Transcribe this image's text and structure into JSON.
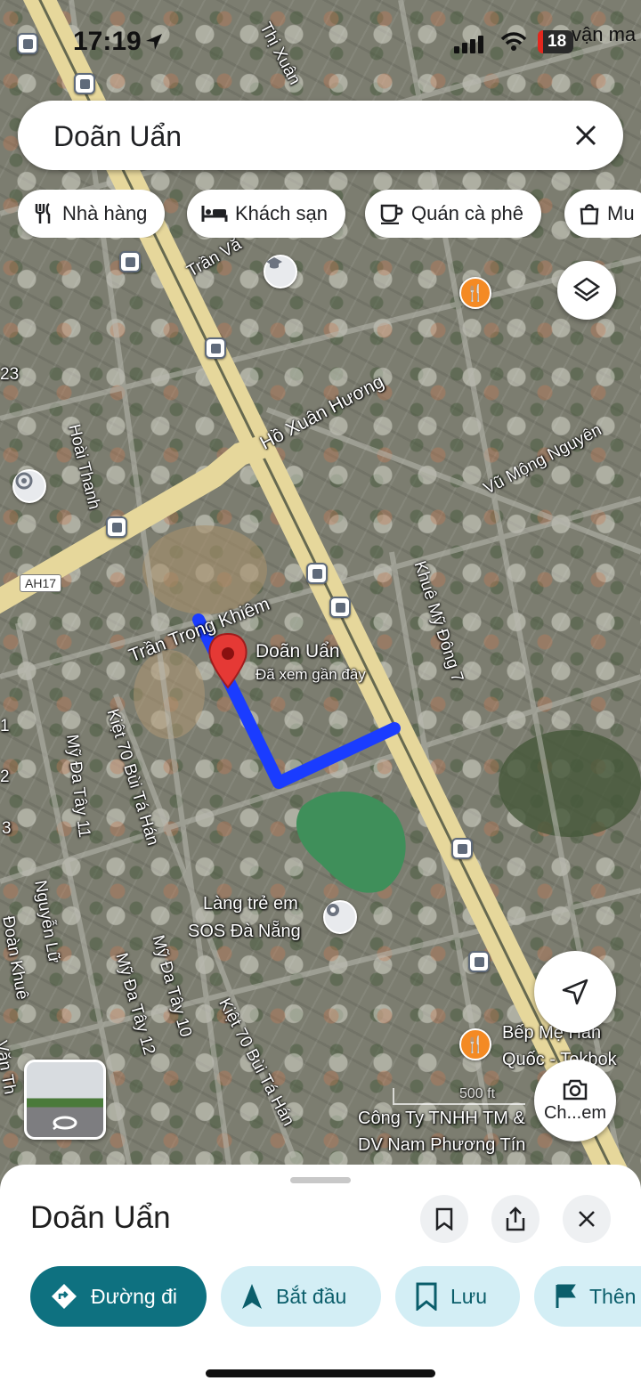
{
  "status_bar": {
    "time": "17:19",
    "battery": "18",
    "carrier": "vận ma"
  },
  "search": {
    "query": "Doãn Uẩn"
  },
  "chips": [
    {
      "label": "Nhà hàng",
      "icon": "restaurant-icon"
    },
    {
      "label": "Khách sạn",
      "icon": "hotel-icon"
    },
    {
      "label": "Quán cà phê",
      "icon": "coffee-icon"
    },
    {
      "label": "Mu",
      "icon": "shopping-icon"
    }
  ],
  "map": {
    "streets": {
      "thi_xuan": "Thị Xuân",
      "tran_van": "Trần Vă",
      "ho_xuan_huong": "Hồ Xuân Hương",
      "vu_mong_nguyen": "Vũ Mộng Nguyên",
      "hoai_thanh": "Hoài Thanh",
      "tran_trong_khiem": "Trần Trọng Khiêm",
      "khue_my_dong_7": "Khuê Mỹ Đông 7",
      "kiet_70_bui_ta_han_1": "Kiệt 70 Bùi Tá Hán",
      "my_da_tay_11": "Mỹ Đa Tây 11",
      "nguyen_lu": "Nguyễn Lữ",
      "doan_khue": "Đoàn Khuê",
      "my_da_tay_12": "Mỹ Đa Tây 12",
      "my_da_tay_10": "Mỹ Đa Tây 10",
      "kiet_70_bui_ta_han_2": "Kiệt 70 Bùi Tá Hán",
      "van_th": "Văn Th",
      "edge_23": "23",
      "edge_2": "2",
      "edge_3": "3",
      "edge_1": "1"
    },
    "route_shield": "AH17",
    "pin": {
      "name": "Doãn Uẩn",
      "subtitle": "Đã xem gần đây"
    },
    "places": {
      "sos_line1": "Làng trẻ em",
      "sos_line2": "SOS Đà Nẵng",
      "bep_line1": "Bếp Mẹ Hàn",
      "bep_line2": "Quốc - Tokbok",
      "cty_line1": "Công Ty TNHH TM &",
      "cty_line2": "DV Nam Phương Tín",
      "scale": "500 ft"
    },
    "lens_label": "Ch...em",
    "colors": {
      "route": "#1a3cff",
      "pin": "#e53935",
      "main_road": "#e6d79b"
    }
  },
  "sheet": {
    "title": "Doãn Uẩn",
    "actions": [
      {
        "label": "Đường đi",
        "icon": "directions-icon"
      },
      {
        "label": "Bắt đầu",
        "icon": "navigation-icon"
      },
      {
        "label": "Lưu",
        "icon": "bookmark-icon"
      },
      {
        "label": "Thên",
        "icon": "flag-icon"
      }
    ]
  },
  "colors": {
    "primary_action": "#0e7180",
    "secondary_action": "#d3eef5"
  }
}
